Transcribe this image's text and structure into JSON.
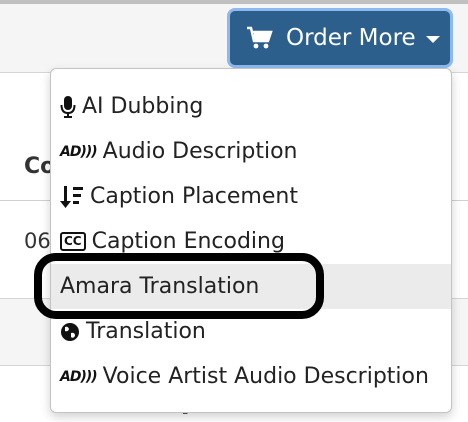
{
  "header": {
    "order_button_label": "Order More"
  },
  "table": {
    "column_header": "Co",
    "row_value": "06"
  },
  "footer_text": "… [",
  "menu": {
    "items": [
      {
        "label": "AI Dubbing",
        "icon": "microphone-icon"
      },
      {
        "label": "Audio Description",
        "icon": "audio-description-icon"
      },
      {
        "label": "Caption Placement",
        "icon": "sort-down-icon"
      },
      {
        "label": "Caption Encoding",
        "icon": "closed-caption-icon"
      },
      {
        "label": "Amara Translation",
        "icon": "none"
      },
      {
        "label": "Translation",
        "icon": "globe-icon"
      },
      {
        "label": "Voice Artist Audio Description",
        "icon": "audio-description-icon"
      }
    ],
    "active_index": 4
  },
  "colors": {
    "button_bg": "#2d5f8c",
    "button_focus_ring": "#8db8f0",
    "active_item_bg": "#ebebeb",
    "highlight_ring": "#000000"
  }
}
